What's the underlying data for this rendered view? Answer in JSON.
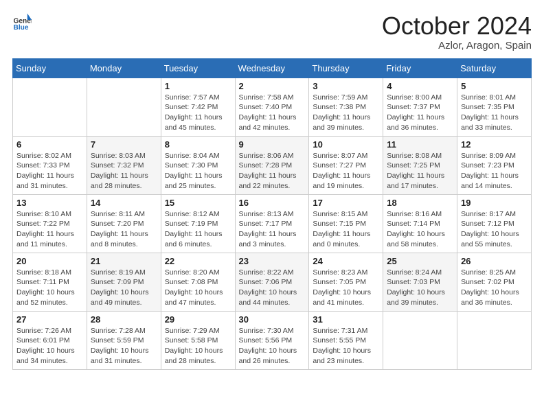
{
  "logo": {
    "text_general": "General",
    "text_blue": "Blue"
  },
  "header": {
    "month": "October 2024",
    "location": "Azlor, Aragon, Spain"
  },
  "days_of_week": [
    "Sunday",
    "Monday",
    "Tuesday",
    "Wednesday",
    "Thursday",
    "Friday",
    "Saturday"
  ],
  "weeks": [
    [
      {
        "day": "",
        "sunrise": "",
        "sunset": "",
        "daylight": ""
      },
      {
        "day": "",
        "sunrise": "",
        "sunset": "",
        "daylight": ""
      },
      {
        "day": "1",
        "sunrise": "Sunrise: 7:57 AM",
        "sunset": "Sunset: 7:42 PM",
        "daylight": "Daylight: 11 hours and 45 minutes."
      },
      {
        "day": "2",
        "sunrise": "Sunrise: 7:58 AM",
        "sunset": "Sunset: 7:40 PM",
        "daylight": "Daylight: 11 hours and 42 minutes."
      },
      {
        "day": "3",
        "sunrise": "Sunrise: 7:59 AM",
        "sunset": "Sunset: 7:38 PM",
        "daylight": "Daylight: 11 hours and 39 minutes."
      },
      {
        "day": "4",
        "sunrise": "Sunrise: 8:00 AM",
        "sunset": "Sunset: 7:37 PM",
        "daylight": "Daylight: 11 hours and 36 minutes."
      },
      {
        "day": "5",
        "sunrise": "Sunrise: 8:01 AM",
        "sunset": "Sunset: 7:35 PM",
        "daylight": "Daylight: 11 hours and 33 minutes."
      }
    ],
    [
      {
        "day": "6",
        "sunrise": "Sunrise: 8:02 AM",
        "sunset": "Sunset: 7:33 PM",
        "daylight": "Daylight: 11 hours and 31 minutes."
      },
      {
        "day": "7",
        "sunrise": "Sunrise: 8:03 AM",
        "sunset": "Sunset: 7:32 PM",
        "daylight": "Daylight: 11 hours and 28 minutes."
      },
      {
        "day": "8",
        "sunrise": "Sunrise: 8:04 AM",
        "sunset": "Sunset: 7:30 PM",
        "daylight": "Daylight: 11 hours and 25 minutes."
      },
      {
        "day": "9",
        "sunrise": "Sunrise: 8:06 AM",
        "sunset": "Sunset: 7:28 PM",
        "daylight": "Daylight: 11 hours and 22 minutes."
      },
      {
        "day": "10",
        "sunrise": "Sunrise: 8:07 AM",
        "sunset": "Sunset: 7:27 PM",
        "daylight": "Daylight: 11 hours and 19 minutes."
      },
      {
        "day": "11",
        "sunrise": "Sunrise: 8:08 AM",
        "sunset": "Sunset: 7:25 PM",
        "daylight": "Daylight: 11 hours and 17 minutes."
      },
      {
        "day": "12",
        "sunrise": "Sunrise: 8:09 AM",
        "sunset": "Sunset: 7:23 PM",
        "daylight": "Daylight: 11 hours and 14 minutes."
      }
    ],
    [
      {
        "day": "13",
        "sunrise": "Sunrise: 8:10 AM",
        "sunset": "Sunset: 7:22 PM",
        "daylight": "Daylight: 11 hours and 11 minutes."
      },
      {
        "day": "14",
        "sunrise": "Sunrise: 8:11 AM",
        "sunset": "Sunset: 7:20 PM",
        "daylight": "Daylight: 11 hours and 8 minutes."
      },
      {
        "day": "15",
        "sunrise": "Sunrise: 8:12 AM",
        "sunset": "Sunset: 7:19 PM",
        "daylight": "Daylight: 11 hours and 6 minutes."
      },
      {
        "day": "16",
        "sunrise": "Sunrise: 8:13 AM",
        "sunset": "Sunset: 7:17 PM",
        "daylight": "Daylight: 11 hours and 3 minutes."
      },
      {
        "day": "17",
        "sunrise": "Sunrise: 8:15 AM",
        "sunset": "Sunset: 7:15 PM",
        "daylight": "Daylight: 11 hours and 0 minutes."
      },
      {
        "day": "18",
        "sunrise": "Sunrise: 8:16 AM",
        "sunset": "Sunset: 7:14 PM",
        "daylight": "Daylight: 10 hours and 58 minutes."
      },
      {
        "day": "19",
        "sunrise": "Sunrise: 8:17 AM",
        "sunset": "Sunset: 7:12 PM",
        "daylight": "Daylight: 10 hours and 55 minutes."
      }
    ],
    [
      {
        "day": "20",
        "sunrise": "Sunrise: 8:18 AM",
        "sunset": "Sunset: 7:11 PM",
        "daylight": "Daylight: 10 hours and 52 minutes."
      },
      {
        "day": "21",
        "sunrise": "Sunrise: 8:19 AM",
        "sunset": "Sunset: 7:09 PM",
        "daylight": "Daylight: 10 hours and 49 minutes."
      },
      {
        "day": "22",
        "sunrise": "Sunrise: 8:20 AM",
        "sunset": "Sunset: 7:08 PM",
        "daylight": "Daylight: 10 hours and 47 minutes."
      },
      {
        "day": "23",
        "sunrise": "Sunrise: 8:22 AM",
        "sunset": "Sunset: 7:06 PM",
        "daylight": "Daylight: 10 hours and 44 minutes."
      },
      {
        "day": "24",
        "sunrise": "Sunrise: 8:23 AM",
        "sunset": "Sunset: 7:05 PM",
        "daylight": "Daylight: 10 hours and 41 minutes."
      },
      {
        "day": "25",
        "sunrise": "Sunrise: 8:24 AM",
        "sunset": "Sunset: 7:03 PM",
        "daylight": "Daylight: 10 hours and 39 minutes."
      },
      {
        "day": "26",
        "sunrise": "Sunrise: 8:25 AM",
        "sunset": "Sunset: 7:02 PM",
        "daylight": "Daylight: 10 hours and 36 minutes."
      }
    ],
    [
      {
        "day": "27",
        "sunrise": "Sunrise: 7:26 AM",
        "sunset": "Sunset: 6:01 PM",
        "daylight": "Daylight: 10 hours and 34 minutes."
      },
      {
        "day": "28",
        "sunrise": "Sunrise: 7:28 AM",
        "sunset": "Sunset: 5:59 PM",
        "daylight": "Daylight: 10 hours and 31 minutes."
      },
      {
        "day": "29",
        "sunrise": "Sunrise: 7:29 AM",
        "sunset": "Sunset: 5:58 PM",
        "daylight": "Daylight: 10 hours and 28 minutes."
      },
      {
        "day": "30",
        "sunrise": "Sunrise: 7:30 AM",
        "sunset": "Sunset: 5:56 PM",
        "daylight": "Daylight: 10 hours and 26 minutes."
      },
      {
        "day": "31",
        "sunrise": "Sunrise: 7:31 AM",
        "sunset": "Sunset: 5:55 PM",
        "daylight": "Daylight: 10 hours and 23 minutes."
      },
      {
        "day": "",
        "sunrise": "",
        "sunset": "",
        "daylight": ""
      },
      {
        "day": "",
        "sunrise": "",
        "sunset": "",
        "daylight": ""
      }
    ]
  ]
}
